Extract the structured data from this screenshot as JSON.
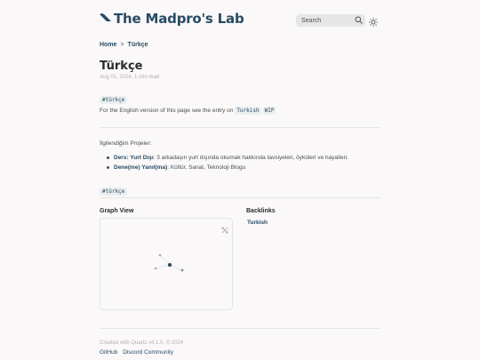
{
  "site": {
    "title": "The Madpro's Lab"
  },
  "search": {
    "placeholder": "Search"
  },
  "breadcrumb": {
    "home": "Home",
    "separator": ">",
    "current": "Türkçe"
  },
  "page": {
    "title": "Türkçe",
    "meta": "Aug 01, 2024, 1 min read",
    "tag": "#türkçe",
    "english_prefix": "For the English version of this page see the entry on",
    "english_link": "Turkish",
    "wip": "WIP",
    "projects_label": "İlgilendiğim Projeler:",
    "projects": [
      {
        "name": "Ders: Yurt Dışı",
        "desc": ": 3 arkadaşın yurt dışında okumak hakkında tavsiyeleri, öyküleri ve hayalleri."
      },
      {
        "name": "Dene(me) Yanıl(ma)",
        "desc": ": Kültür, Sanat, Teknoloji Blogu"
      }
    ],
    "bottom_tag": "#türkçe"
  },
  "graph": {
    "heading": "Graph View"
  },
  "backlinks": {
    "heading": "Backlinks",
    "items": [
      "Turkish"
    ]
  },
  "footer": {
    "created_with": "Created with Quartz v4.1.0, © 2024",
    "links": [
      "GitHub",
      "Discord Community"
    ]
  },
  "colors": {
    "accent": "#284b63",
    "node": "#284b63",
    "node_muted": "#b3aeae",
    "tag_bg": "#eaeef0"
  }
}
